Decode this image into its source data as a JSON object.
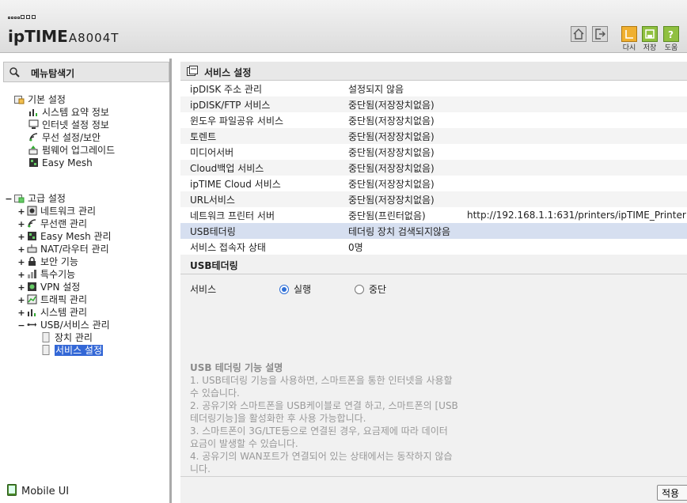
{
  "header": {
    "brand": "ipTIME",
    "model": "A8004T",
    "buttons": [
      {
        "icon": "home-icon",
        "label": ""
      },
      {
        "icon": "logout-icon",
        "label": ""
      },
      {
        "icon": "reload-icon",
        "label": "다시"
      },
      {
        "icon": "save-icon",
        "label": "저장"
      },
      {
        "icon": "help-icon",
        "label": "도움"
      }
    ]
  },
  "nav": {
    "title": "메뉴탐색기",
    "basic": {
      "label": "기본 설정",
      "items": [
        "시스템 요약 정보",
        "인터넷 설정 정보",
        "무선 설정/보안",
        "펌웨어 업그레이드",
        "Easy Mesh"
      ]
    },
    "advanced": {
      "toggle": "−",
      "label": "고급 설정",
      "items": [
        {
          "toggle": "+",
          "label": "네트워크 관리"
        },
        {
          "toggle": "+",
          "label": "무선랜 관리"
        },
        {
          "toggle": "+",
          "label": "Easy Mesh 관리"
        },
        {
          "toggle": "+",
          "label": "NAT/라우터 관리"
        },
        {
          "toggle": "+",
          "label": "보안 기능"
        },
        {
          "toggle": "+",
          "label": "특수기능"
        },
        {
          "toggle": "+",
          "label": "VPN 설정"
        },
        {
          "toggle": "+",
          "label": "트래픽 관리"
        },
        {
          "toggle": "+",
          "label": "시스템 관리"
        },
        {
          "toggle": "−",
          "label": "USB/서비스 관리"
        }
      ],
      "usb_children": [
        "장치 관리",
        "서비스 설정"
      ]
    },
    "mobile": "Mobile UI"
  },
  "main": {
    "title": "서비스 설정",
    "rows": [
      {
        "name": "ipDISK 주소 관리",
        "status": "설정되지 않음",
        "extra": ""
      },
      {
        "name": "ipDISK/FTP 서비스",
        "status": "중단됨(저장장치없음)",
        "extra": ""
      },
      {
        "name": "윈도우 파일공유 서비스",
        "status": "중단됨(저장장치없음)",
        "extra": ""
      },
      {
        "name": "토렌트",
        "status": "중단됨(저장장치없음)",
        "extra": ""
      },
      {
        "name": "미디어서버",
        "status": "중단됨(저장장치없음)",
        "extra": ""
      },
      {
        "name": "Cloud백업 서비스",
        "status": "중단됨(저장장치없음)",
        "extra": ""
      },
      {
        "name": "ipTIME Cloud 서비스",
        "status": "중단됨(저장장치없음)",
        "extra": ""
      },
      {
        "name": "URL서비스",
        "status": "중단됨(저장장치없음)",
        "extra": ""
      },
      {
        "name": "네트워크 프린터 서버",
        "status": "중단됨(프린터없음)",
        "extra": "http://192.168.1.1:631/printers/ipTIME_Printer"
      },
      {
        "name": "USB테더링",
        "status": "테더링 장치 검색되지않음",
        "extra": ""
      },
      {
        "name": "서비스 접속자 상태",
        "status": "0명",
        "extra": ""
      }
    ],
    "usb_section": {
      "title": "USB테더링",
      "service_label": "서비스",
      "option_run": "실행",
      "option_stop": "중단",
      "selected": "실행"
    },
    "description": {
      "title": "USB 테더링 기능 설명",
      "lines": [
        "1. USB테더링 기능을 사용하면, 스마트폰을 통한 인터넷을 사용할",
        "수 있습니다.",
        "2. 공유기와 스마트폰을 USB케이블로 연결 하고, 스마트폰의 [USB",
        "테더링기능]을 활성화한 후 사용 가능합니다.",
        "3. 스마트폰이 3G/LTE등으로 연결된 경우, 요금제에 따라 데이터",
        "요금이 발생할 수 있습니다.",
        "4. 공유기의 WAN포트가 연결되어 있는 상태에서는 동작하지 않습",
        "니다."
      ]
    },
    "apply_label": "적용"
  }
}
